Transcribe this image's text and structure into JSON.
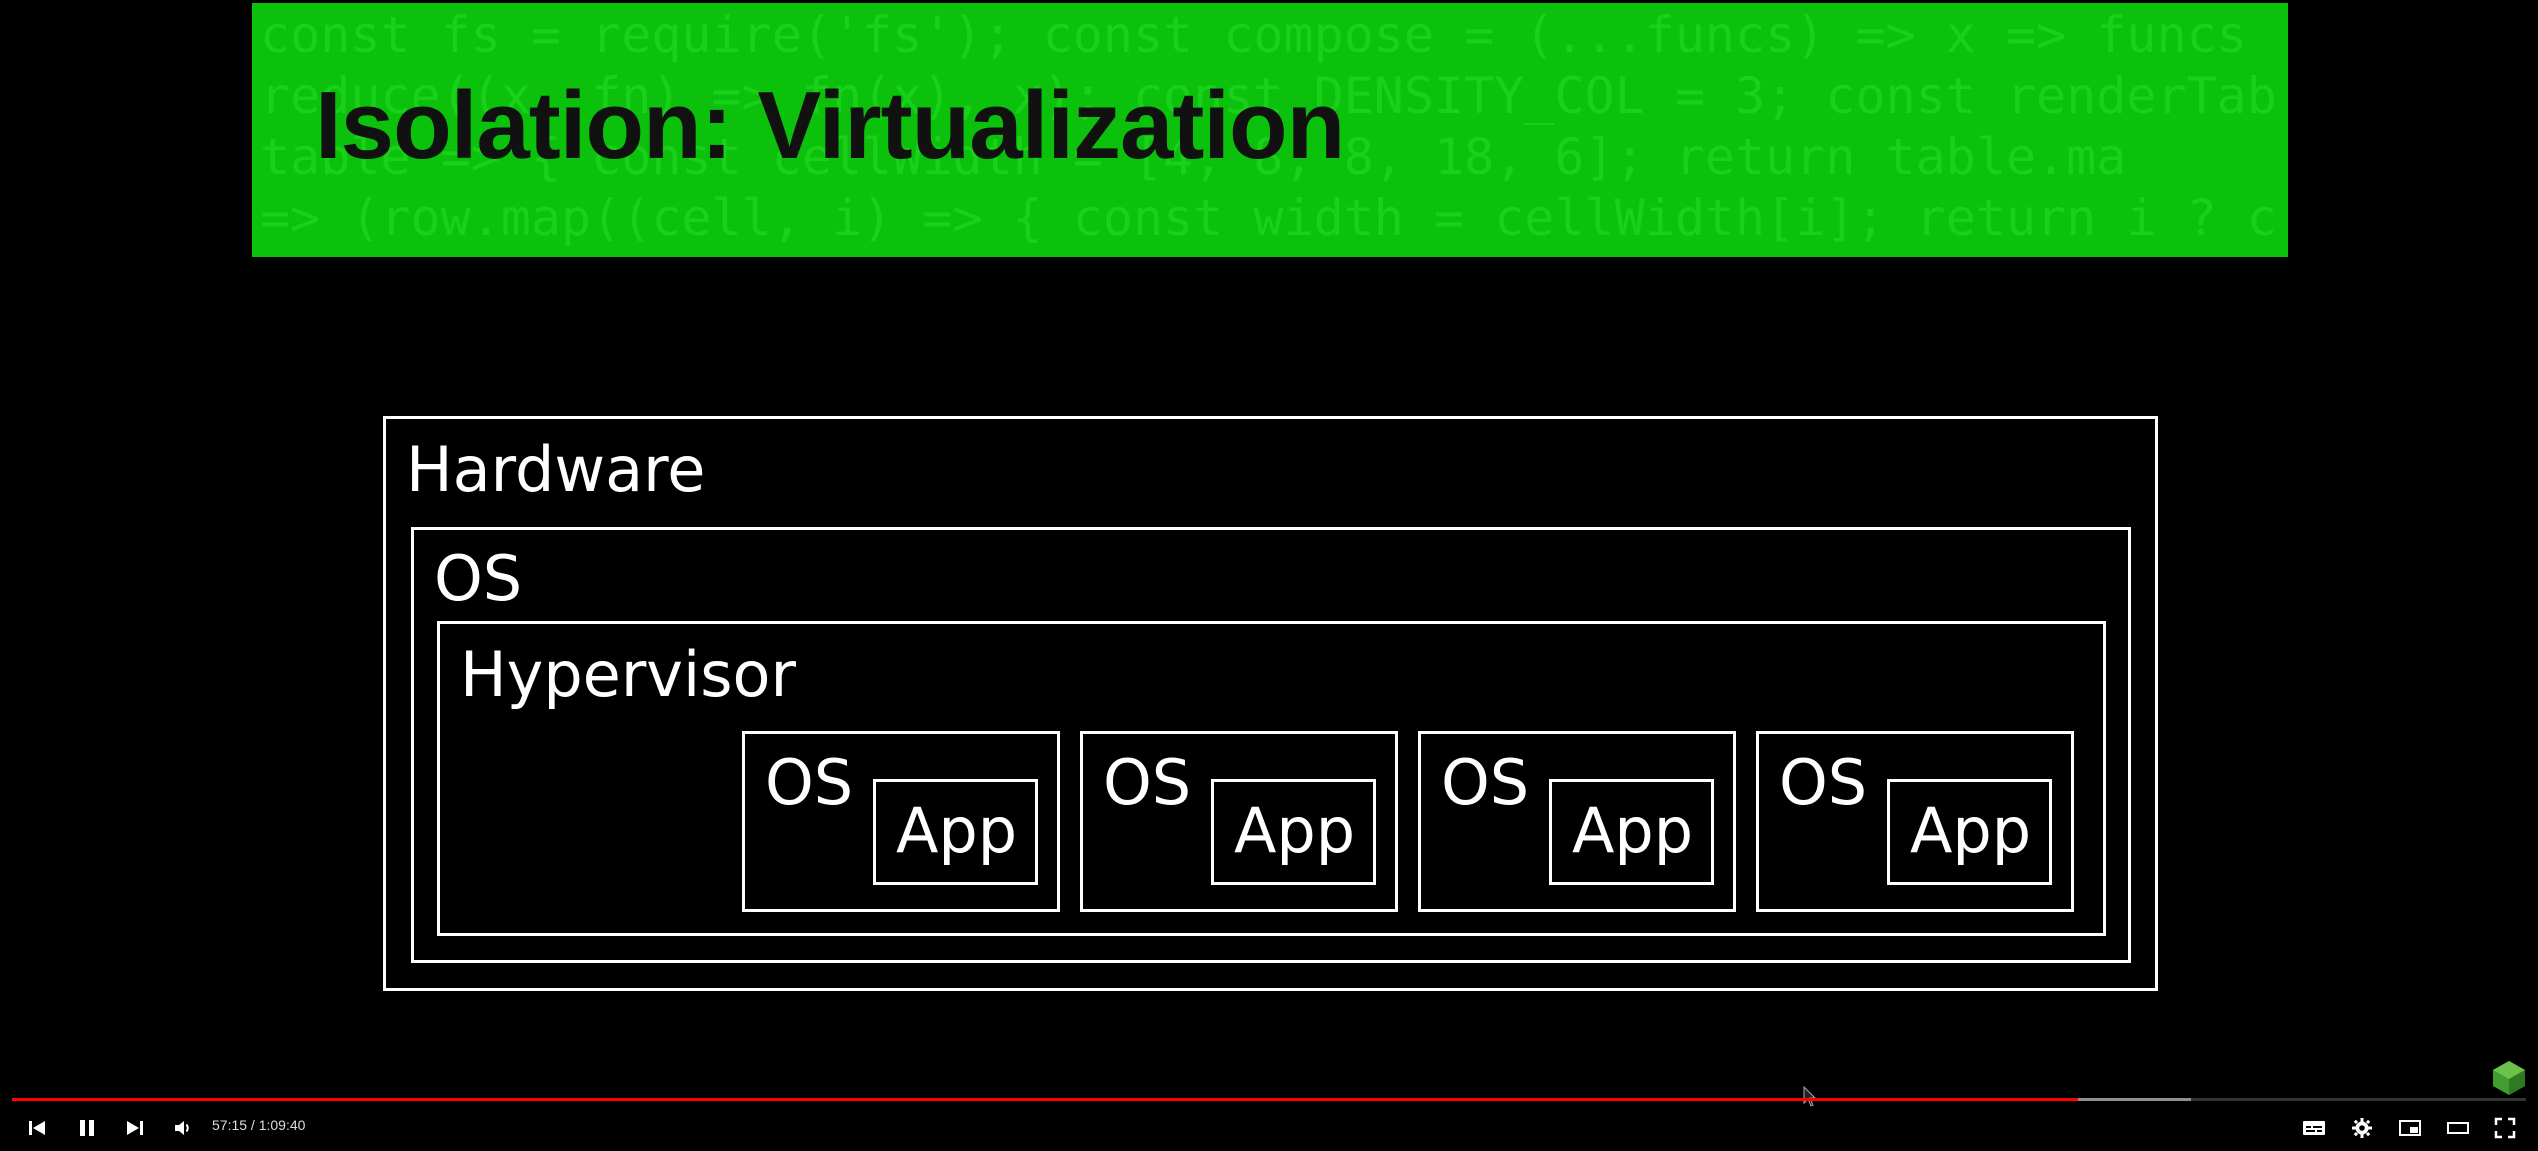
{
  "slide": {
    "title": "Isolation: Virtualization",
    "code_lines": [
      "const fs = require('fs'); const compose = (...funcs) => x => funcs",
      "reduce((x, fn) => fn(x), x); const DENSITY_COL = 3; const renderTab",
      "table => { const cellWidth = [4, 8, 8, 18, 6]; return table.ma",
      "=> (row.map((cell, i) => { const width = cellWidth[i]; return i ? c"
    ],
    "diagram": {
      "hardware_label": "Hardware",
      "os_label": "OS",
      "hypervisor_label": "Hypervisor",
      "vms": [
        {
          "os_label": "OS",
          "app_label": "App"
        },
        {
          "os_label": "OS",
          "app_label": "App"
        },
        {
          "os_label": "OS",
          "app_label": "App"
        },
        {
          "os_label": "OS",
          "app_label": "App"
        }
      ]
    },
    "colors": {
      "banner": "#0bc10b",
      "background": "#000000",
      "diagram_stroke": "#ffffff"
    }
  },
  "player": {
    "current_time": "57:15",
    "separator": " / ",
    "duration": "1:09:40",
    "progress_fraction": 0.8218,
    "buffered_fraction": 0.8668,
    "progress_color": "#ff0000",
    "icons": {
      "previous": "skip-previous-icon",
      "pause": "pause-icon",
      "next": "skip-next-icon",
      "volume": "volume-icon",
      "subtitles": "subtitles-icon",
      "settings": "gear-icon",
      "miniplayer": "miniplayer-icon",
      "theater": "theater-mode-icon",
      "fullscreen": "fullscreen-icon"
    }
  }
}
